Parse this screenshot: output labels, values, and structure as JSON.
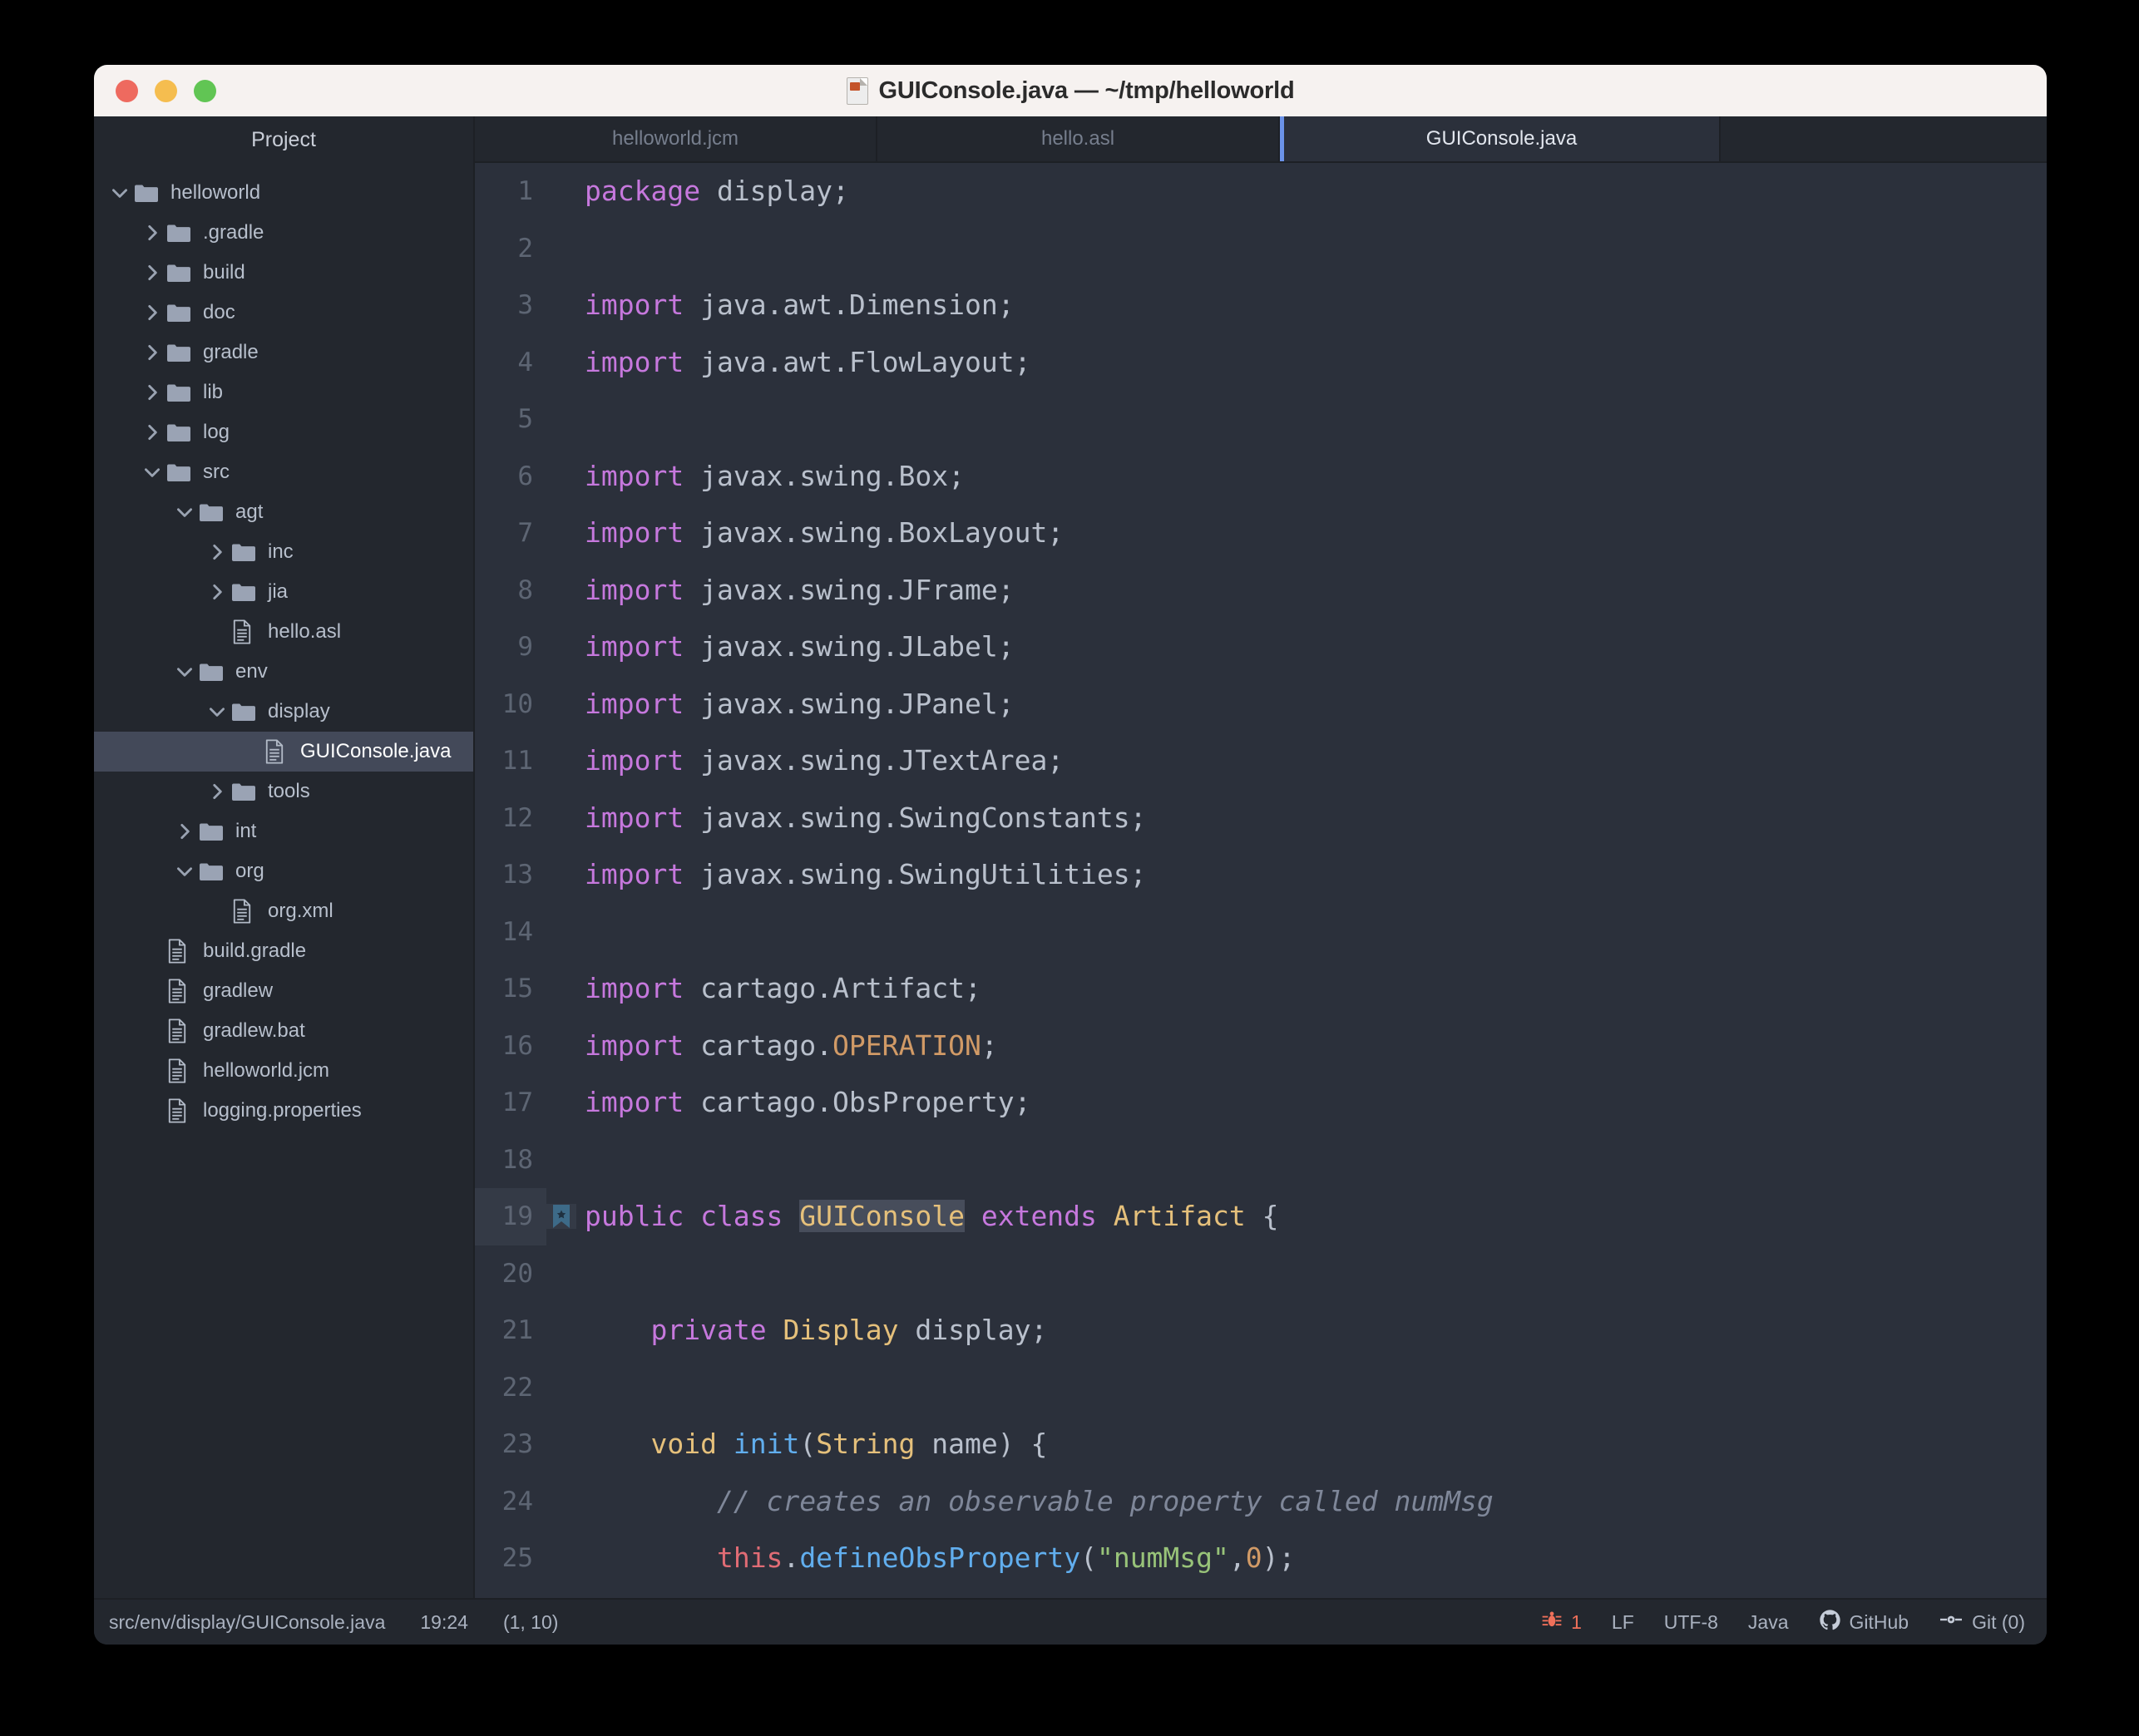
{
  "window": {
    "title": "GUIConsole.java — ~/tmp/helloworld",
    "title_icon": "java-file-icon",
    "traffic_lights": [
      "close-button",
      "minimize-button",
      "zoom-button"
    ]
  },
  "sidebar": {
    "header": "Project",
    "tree": [
      {
        "label": "helloworld",
        "type": "folder",
        "state": "expanded",
        "depth": 0,
        "selected": false
      },
      {
        "label": ".gradle",
        "type": "folder",
        "state": "collapsed",
        "depth": 1,
        "selected": false
      },
      {
        "label": "build",
        "type": "folder",
        "state": "collapsed",
        "depth": 1,
        "selected": false
      },
      {
        "label": "doc",
        "type": "folder",
        "state": "collapsed",
        "depth": 1,
        "selected": false
      },
      {
        "label": "gradle",
        "type": "folder",
        "state": "collapsed",
        "depth": 1,
        "selected": false
      },
      {
        "label": "lib",
        "type": "folder",
        "state": "collapsed",
        "depth": 1,
        "selected": false
      },
      {
        "label": "log",
        "type": "folder",
        "state": "collapsed",
        "depth": 1,
        "selected": false
      },
      {
        "label": "src",
        "type": "folder",
        "state": "expanded",
        "depth": 1,
        "selected": false
      },
      {
        "label": "agt",
        "type": "folder",
        "state": "expanded",
        "depth": 2,
        "selected": false
      },
      {
        "label": "inc",
        "type": "folder",
        "state": "collapsed",
        "depth": 3,
        "selected": false
      },
      {
        "label": "jia",
        "type": "folder",
        "state": "collapsed",
        "depth": 3,
        "selected": false
      },
      {
        "label": "hello.asl",
        "type": "file",
        "state": "leaf",
        "depth": 3,
        "selected": false
      },
      {
        "label": "env",
        "type": "folder",
        "state": "expanded",
        "depth": 2,
        "selected": false
      },
      {
        "label": "display",
        "type": "folder",
        "state": "expanded",
        "depth": 3,
        "selected": false
      },
      {
        "label": "GUIConsole.java",
        "type": "file",
        "state": "leaf",
        "depth": 4,
        "selected": true
      },
      {
        "label": "tools",
        "type": "folder",
        "state": "collapsed",
        "depth": 3,
        "selected": false
      },
      {
        "label": "int",
        "type": "folder",
        "state": "collapsed",
        "depth": 2,
        "selected": false
      },
      {
        "label": "org",
        "type": "folder",
        "state": "expanded",
        "depth": 2,
        "selected": false
      },
      {
        "label": "org.xml",
        "type": "file",
        "state": "leaf",
        "depth": 3,
        "selected": false
      },
      {
        "label": "build.gradle",
        "type": "file",
        "state": "leaf",
        "depth": 1,
        "selected": false
      },
      {
        "label": "gradlew",
        "type": "file",
        "state": "leaf",
        "depth": 1,
        "selected": false
      },
      {
        "label": "gradlew.bat",
        "type": "file",
        "state": "leaf",
        "depth": 1,
        "selected": false
      },
      {
        "label": "helloworld.jcm",
        "type": "file",
        "state": "leaf",
        "depth": 1,
        "selected": false
      },
      {
        "label": "logging.properties",
        "type": "file",
        "state": "leaf",
        "depth": 1,
        "selected": false
      }
    ]
  },
  "tabs": [
    {
      "label": "helloworld.jcm",
      "active": false
    },
    {
      "label": "hello.asl",
      "active": false
    },
    {
      "label": "GUIConsole.java",
      "active": true
    }
  ],
  "editor": {
    "first_line": 1,
    "bookmarked_line": 19,
    "selected_token": "GUIConsole",
    "lines": [
      {
        "n": "1",
        "tokens": [
          {
            "t": "package",
            "c": "kw"
          },
          {
            "t": " display;",
            "c": "pln"
          }
        ]
      },
      {
        "n": "2",
        "tokens": []
      },
      {
        "n": "3",
        "tokens": [
          {
            "t": "import",
            "c": "kw"
          },
          {
            "t": " java.awt.Dimension;",
            "c": "pln"
          }
        ]
      },
      {
        "n": "4",
        "tokens": [
          {
            "t": "import",
            "c": "kw"
          },
          {
            "t": " java.awt.FlowLayout;",
            "c": "pln"
          }
        ]
      },
      {
        "n": "5",
        "tokens": []
      },
      {
        "n": "6",
        "tokens": [
          {
            "t": "import",
            "c": "kw"
          },
          {
            "t": " javax.swing.Box;",
            "c": "pln"
          }
        ]
      },
      {
        "n": "7",
        "tokens": [
          {
            "t": "import",
            "c": "kw"
          },
          {
            "t": " javax.swing.BoxLayout;",
            "c": "pln"
          }
        ]
      },
      {
        "n": "8",
        "tokens": [
          {
            "t": "import",
            "c": "kw"
          },
          {
            "t": " javax.swing.JFrame;",
            "c": "pln"
          }
        ]
      },
      {
        "n": "9",
        "tokens": [
          {
            "t": "import",
            "c": "kw"
          },
          {
            "t": " javax.swing.JLabel;",
            "c": "pln"
          }
        ]
      },
      {
        "n": "10",
        "tokens": [
          {
            "t": "import",
            "c": "kw"
          },
          {
            "t": " javax.swing.JPanel;",
            "c": "pln"
          }
        ]
      },
      {
        "n": "11",
        "tokens": [
          {
            "t": "import",
            "c": "kw"
          },
          {
            "t": " javax.swing.JTextArea;",
            "c": "pln"
          }
        ]
      },
      {
        "n": "12",
        "tokens": [
          {
            "t": "import",
            "c": "kw"
          },
          {
            "t": " javax.swing.SwingConstants;",
            "c": "pln"
          }
        ]
      },
      {
        "n": "13",
        "tokens": [
          {
            "t": "import",
            "c": "kw"
          },
          {
            "t": " javax.swing.SwingUtilities;",
            "c": "pln"
          }
        ]
      },
      {
        "n": "14",
        "tokens": []
      },
      {
        "n": "15",
        "tokens": [
          {
            "t": "import",
            "c": "kw"
          },
          {
            "t": " cartago.Artifact;",
            "c": "pln"
          }
        ]
      },
      {
        "n": "16",
        "tokens": [
          {
            "t": "import",
            "c": "kw"
          },
          {
            "t": " cartago.",
            "c": "pln"
          },
          {
            "t": "OPERATION",
            "c": "anno"
          },
          {
            "t": ";",
            "c": "pln"
          }
        ]
      },
      {
        "n": "17",
        "tokens": [
          {
            "t": "import",
            "c": "kw"
          },
          {
            "t": " cartago.ObsProperty;",
            "c": "pln"
          }
        ]
      },
      {
        "n": "18",
        "tokens": []
      },
      {
        "n": "19",
        "tokens": [
          {
            "t": "public class ",
            "c": "kw"
          },
          {
            "t": "GUIConsole",
            "c": "typ sel"
          },
          {
            "t": " extends ",
            "c": "kw"
          },
          {
            "t": "Artifact",
            "c": "typ"
          },
          {
            "t": " {",
            "c": "pln"
          }
        ]
      },
      {
        "n": "20",
        "tokens": []
      },
      {
        "n": "21",
        "tokens": [
          {
            "t": "    ",
            "c": "pln"
          },
          {
            "t": "private ",
            "c": "kw"
          },
          {
            "t": "Display",
            "c": "typ"
          },
          {
            "t": " display;",
            "c": "pln"
          }
        ]
      },
      {
        "n": "22",
        "tokens": []
      },
      {
        "n": "23",
        "tokens": [
          {
            "t": "    ",
            "c": "pln"
          },
          {
            "t": "void",
            "c": "typ"
          },
          {
            "t": " ",
            "c": "pln"
          },
          {
            "t": "init",
            "c": "fn"
          },
          {
            "t": "(",
            "c": "pln"
          },
          {
            "t": "String",
            "c": "typ"
          },
          {
            "t": " name) {",
            "c": "pln"
          }
        ]
      },
      {
        "n": "24",
        "tokens": [
          {
            "t": "        ",
            "c": "pln"
          },
          {
            "t": "// creates an observable property called numMsg",
            "c": "cmt"
          }
        ]
      },
      {
        "n": "25",
        "tokens": [
          {
            "t": "        ",
            "c": "pln"
          },
          {
            "t": "this",
            "c": "self"
          },
          {
            "t": ".",
            "c": "pln"
          },
          {
            "t": "defineObsProperty",
            "c": "fn"
          },
          {
            "t": "(",
            "c": "pln"
          },
          {
            "t": "\"numMsg\"",
            "c": "str"
          },
          {
            "t": ",",
            "c": "pln"
          },
          {
            "t": "0",
            "c": "num"
          },
          {
            "t": ");",
            "c": "pln"
          }
        ]
      }
    ]
  },
  "statusbar": {
    "file_path": "src/env/display/GUIConsole.java",
    "time": "19:24",
    "cursor": "(1, 10)",
    "error_count": "1",
    "line_ending": "LF",
    "encoding": "UTF-8",
    "language": "Java",
    "github": "GitHub",
    "git": "Git (0)"
  },
  "colors": {
    "accent_tab": "#6b92e8",
    "error": "#f0705a",
    "selection": "#434959",
    "bookmark": "#3d6a88"
  }
}
